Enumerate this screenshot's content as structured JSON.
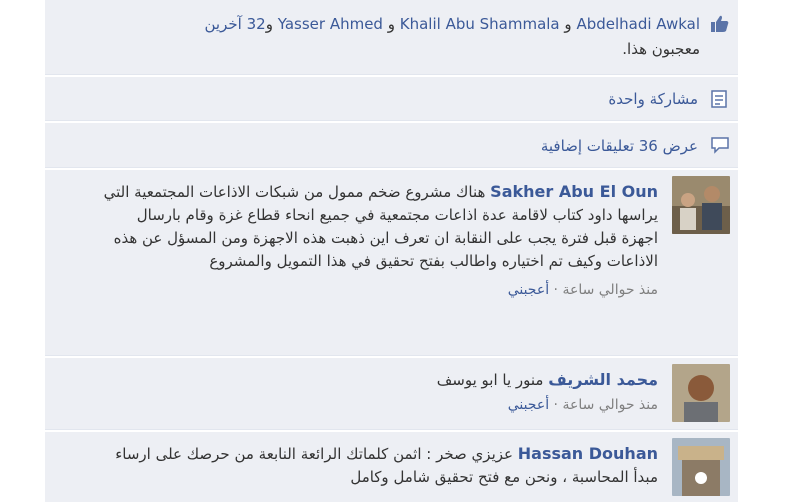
{
  "likes": {
    "likers": [
      "Abdelhadi Awkal",
      "Khalil Abu Shammala",
      "Yasser Ahmed"
    ],
    "joiner": "و",
    "others_count": "32",
    "others_word": "آخرين",
    "tail": "معجبون هذا."
  },
  "shares": {
    "label": "مشاركة واحدة"
  },
  "more_comments": {
    "label": "عرض 36 تعليقات إضافية"
  },
  "comments": [
    {
      "author": "Sakher Abu El Oun",
      "text": "هناك مشروع ضخم ممول من شبكات الاذاعات المجتمعية التي يراسها داود كتاب لاقامة عدة اذاعات مجتمعية في جميع انحاء قطاع غزة وقام بارسال اجهزة قبل فترة يجب على النقابة ان تعرف اين ذهبت هذه الاجهزة ومن المسؤل عن هذه الاذاعات وكيف تم اختياره واطالب بفتح تحقيق في هذا التمويل والمشروع",
      "time": "منذ حوالي ساعة",
      "like": "أعجبني"
    },
    {
      "author": "محمد الشريف",
      "text": "منور يا ابو يوسف",
      "time": "منذ حوالي ساعة",
      "like": "أعجبني"
    },
    {
      "author": "Hassan Douhan",
      "text": "عزيزي صخر : اثمن كلماتك الرائعة النابعة من حرصك على ارساء مبدأ المحاسبة ، ونحن مع فتح تحقيق شامل وكامل",
      "time": "",
      "like": ""
    }
  ],
  "icons": {
    "like": "thumbs-up-icon",
    "share": "share-icon",
    "comments": "speech-bubble-icon"
  },
  "colors": {
    "link": "#3b5998",
    "row_bg": "#edeff4",
    "meta": "#808080"
  }
}
